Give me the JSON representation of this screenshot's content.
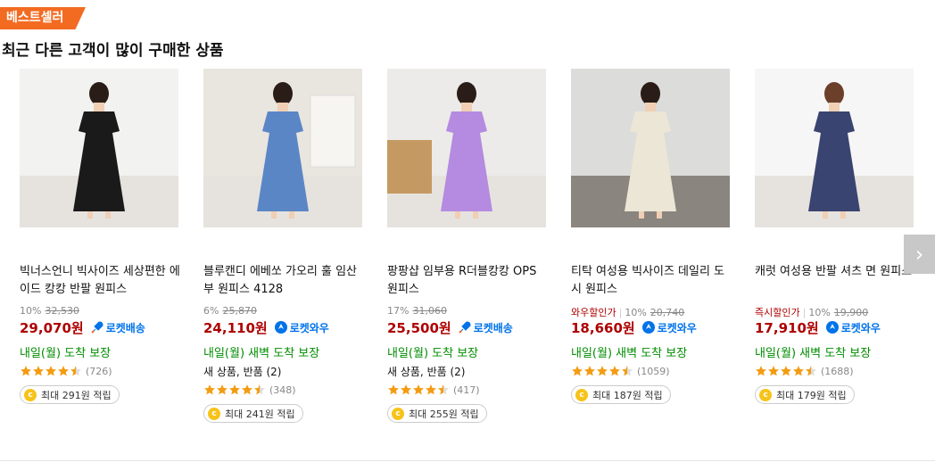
{
  "section": {
    "badge": "베스트셀러",
    "heading": "최근 다른 고객이 많이 구매한 상품"
  },
  "colors": {
    "accent": "#f36b21",
    "price": "#ae0000",
    "rocket": "#0073e9",
    "arrival": "#008c00",
    "star": "#f39c12",
    "coin": "#f7c31a"
  },
  "products": [
    {
      "title": "빅너스언니 빅사이즈 세상편한 에이드 캉캉 반팔 원피스",
      "price_tag": "",
      "discount": "10%",
      "original_price": "32,530",
      "price": "29,070원",
      "delivery_badge": "로켓배송",
      "arrival": "내일(월) 도착 보장",
      "extra": "",
      "rating": 4.5,
      "review_count": "(726)",
      "points": "최대 291원 적립",
      "dress_color": "#1a1a1a",
      "bg_color": "#f2f2f0"
    },
    {
      "title": "블루캔디 에베쏘 가오리 훌 임산부 원피스 4128",
      "price_tag": "",
      "discount": "6%",
      "original_price": "25,870",
      "price": "24,110원",
      "delivery_badge": "로켓와우",
      "arrival": "내일(월) 새벽 도착 보장",
      "extra": "새 상품, 반품 (2)",
      "rating": 4.5,
      "review_count": "(348)",
      "points": "최대 241원 적립",
      "dress_color": "#5b86c6",
      "bg_color": "#e9e5df"
    },
    {
      "title": "팡팡샵 임부용 R더블캉캉 OPS 원피스",
      "price_tag": "",
      "discount": "17%",
      "original_price": "31,060",
      "price": "25,500원",
      "delivery_badge": "로켓배송",
      "arrival": "내일(월) 도착 보장",
      "extra": "새 상품, 반품 (2)",
      "rating": 4.5,
      "review_count": "(417)",
      "points": "최대 255원 적립",
      "dress_color": "#b48be0",
      "bg_color": "#ecebe9"
    },
    {
      "title": "티탁 여성용 빅사이즈 데일리 도시 원피스",
      "price_tag": "와우할인가",
      "discount": "10%",
      "original_price": "20,740",
      "price": "18,660원",
      "delivery_badge": "로켓와우",
      "arrival": "내일(월) 새벽 도착 보장",
      "extra": "",
      "rating": 4.5,
      "review_count": "(1059)",
      "points": "최대 187원 적립",
      "dress_color": "#ece6d6",
      "bg_color": "#dcdcda"
    },
    {
      "title": "캐럿 여성용 반팔 셔츠 면 원피스",
      "price_tag": "즉시할인가",
      "discount": "10%",
      "original_price": "19,900",
      "price": "17,910원",
      "delivery_badge": "로켓와우",
      "arrival": "내일(월) 새벽 도착 보장",
      "extra": "",
      "rating": 4.5,
      "review_count": "(1688)",
      "points": "최대 179원 적립",
      "dress_color": "#3a4470",
      "bg_color": "#f6f6f6"
    }
  ],
  "nav": {
    "next_icon": "chevron-right-icon",
    "next_glyph": "›"
  }
}
